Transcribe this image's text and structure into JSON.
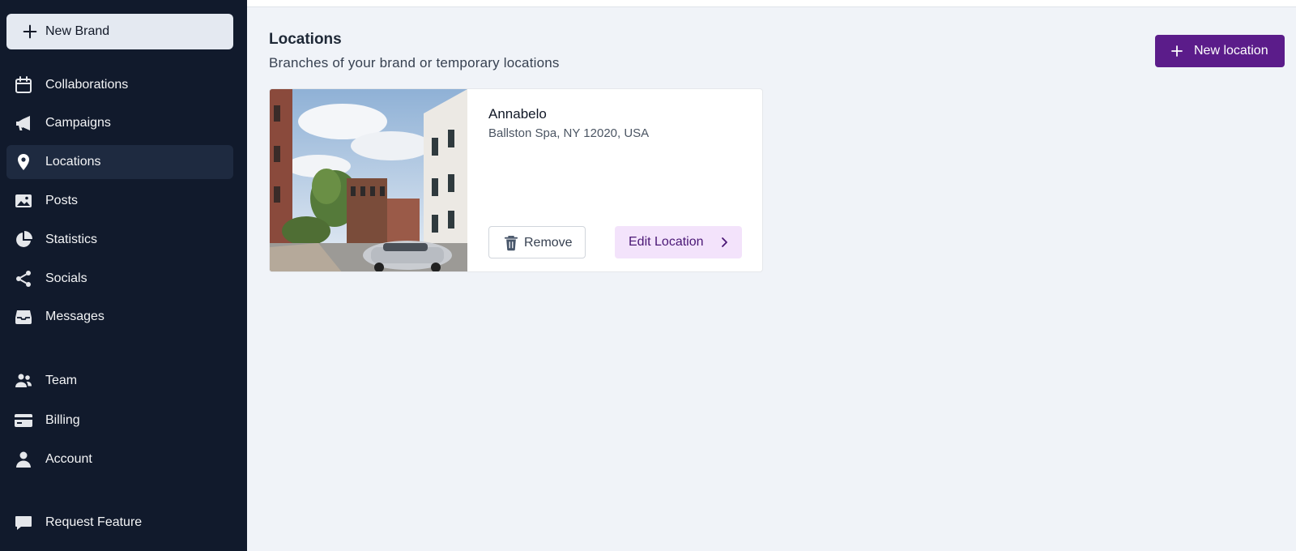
{
  "sidebar": {
    "new_brand_label": "New Brand",
    "items": [
      {
        "label": "Collaborations",
        "icon": "calendar-icon"
      },
      {
        "label": "Campaigns",
        "icon": "megaphone-icon"
      },
      {
        "label": "Locations",
        "icon": "map-pin-icon",
        "active": true
      },
      {
        "label": "Posts",
        "icon": "photo-icon"
      },
      {
        "label": "Statistics",
        "icon": "pie-chart-icon"
      },
      {
        "label": "Socials",
        "icon": "share-icon"
      },
      {
        "label": "Messages",
        "icon": "inbox-icon"
      },
      {
        "label": "Team",
        "icon": "users-icon"
      },
      {
        "label": "Billing",
        "icon": "credit-card-icon"
      },
      {
        "label": "Account",
        "icon": "user-icon"
      },
      {
        "label": "Request Feature",
        "icon": "chat-bubble-icon"
      }
    ]
  },
  "header": {
    "title": "Locations",
    "subtitle": "Branches of your brand or temporary locations",
    "new_location_label": "New location"
  },
  "locations": [
    {
      "name": "Annabelo",
      "address": "Ballston Spa, NY 12020, USA",
      "remove_label": "Remove",
      "edit_label": "Edit Location"
    }
  ],
  "colors": {
    "sidebar_bg": "#111a2c",
    "accent": "#5b1c8a",
    "edit_button_bg": "#f3e3fb",
    "page_bg": "#f0f3f8"
  }
}
